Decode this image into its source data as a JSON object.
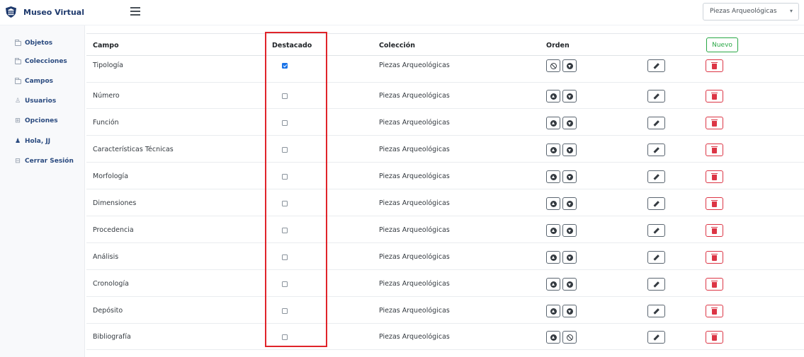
{
  "app": {
    "title": "Museo Virtual"
  },
  "header": {
    "collection_select": {
      "value": "Piezas Arqueológicas"
    }
  },
  "sidebar": {
    "items": [
      {
        "label": "Objetos",
        "icon": "folder-icon"
      },
      {
        "label": "Colecciones",
        "icon": "folder-icon"
      },
      {
        "label": "Campos",
        "icon": "folder-icon"
      },
      {
        "label": "Usuarios",
        "icon": "users-icon"
      },
      {
        "label": "Opciones",
        "icon": "grid-icon"
      },
      {
        "label": "Hola, JJ",
        "icon": "user-icon"
      },
      {
        "label": "Cerrar Sesión",
        "icon": "logout-icon"
      }
    ]
  },
  "table": {
    "headers": {
      "campo": "Campo",
      "destacado": "Destacado",
      "coleccion": "Colección",
      "orden": "Orden"
    },
    "new_button": "Nuevo",
    "rows": [
      {
        "campo": "Tipología",
        "destacado": true,
        "coleccion": "Piezas Arqueológicas",
        "up_enabled": false,
        "down_enabled": true
      },
      {
        "campo": "Número",
        "destacado": false,
        "coleccion": "Piezas Arqueológicas",
        "up_enabled": true,
        "down_enabled": true
      },
      {
        "campo": "Función",
        "destacado": false,
        "coleccion": "Piezas Arqueológicas",
        "up_enabled": true,
        "down_enabled": true
      },
      {
        "campo": "Características Técnicas",
        "destacado": false,
        "coleccion": "Piezas Arqueológicas",
        "up_enabled": true,
        "down_enabled": true
      },
      {
        "campo": "Morfología",
        "destacado": false,
        "coleccion": "Piezas Arqueológicas",
        "up_enabled": true,
        "down_enabled": true
      },
      {
        "campo": "Dimensiones",
        "destacado": false,
        "coleccion": "Piezas Arqueológicas",
        "up_enabled": true,
        "down_enabled": true
      },
      {
        "campo": "Procedencia",
        "destacado": false,
        "coleccion": "Piezas Arqueológicas",
        "up_enabled": true,
        "down_enabled": true
      },
      {
        "campo": "Análisis",
        "destacado": false,
        "coleccion": "Piezas Arqueológicas",
        "up_enabled": true,
        "down_enabled": true
      },
      {
        "campo": "Cronología",
        "destacado": false,
        "coleccion": "Piezas Arqueológicas",
        "up_enabled": true,
        "down_enabled": true
      },
      {
        "campo": "Depósito",
        "destacado": false,
        "coleccion": "Piezas Arqueológicas",
        "up_enabled": true,
        "down_enabled": true
      },
      {
        "campo": "Bibliografía",
        "destacado": false,
        "coleccion": "Piezas Arqueológicas",
        "up_enabled": true,
        "down_enabled": false
      }
    ]
  },
  "colors": {
    "brand": "#1f3a6d",
    "checkbox": "#1a73e8",
    "danger": "#dc3545",
    "success": "#28a745",
    "highlight": "#e0242a"
  }
}
